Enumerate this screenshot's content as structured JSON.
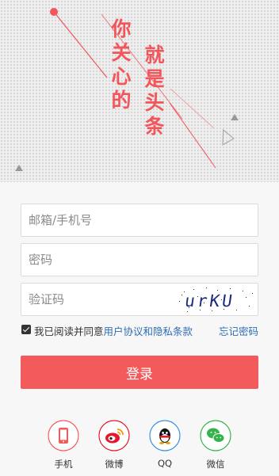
{
  "hero": {
    "slogan_left": "你\n关\n心\n的",
    "slogan_right": "就\n是\n头\n条",
    "accent_color": "#f2555a"
  },
  "form": {
    "account_placeholder": "邮箱/手机号",
    "password_placeholder": "密码",
    "captcha_placeholder": "验证码",
    "captcha_text": "urKU",
    "agree_prefix": "我已阅读并同意",
    "agree_link": "用户协议和隐私条款",
    "agree_checked": true,
    "forgot_label": "忘记密码",
    "login_label": "登录"
  },
  "social": [
    {
      "label": "手机",
      "icon": "phone-icon",
      "color": "#f25a5c"
    },
    {
      "label": "微博",
      "icon": "weibo-icon",
      "color": "#e6162d"
    },
    {
      "label": "QQ",
      "icon": "qq-icon",
      "color": "#3a8ee6"
    },
    {
      "label": "微信",
      "icon": "wechat-icon",
      "color": "#36b34a"
    }
  ]
}
